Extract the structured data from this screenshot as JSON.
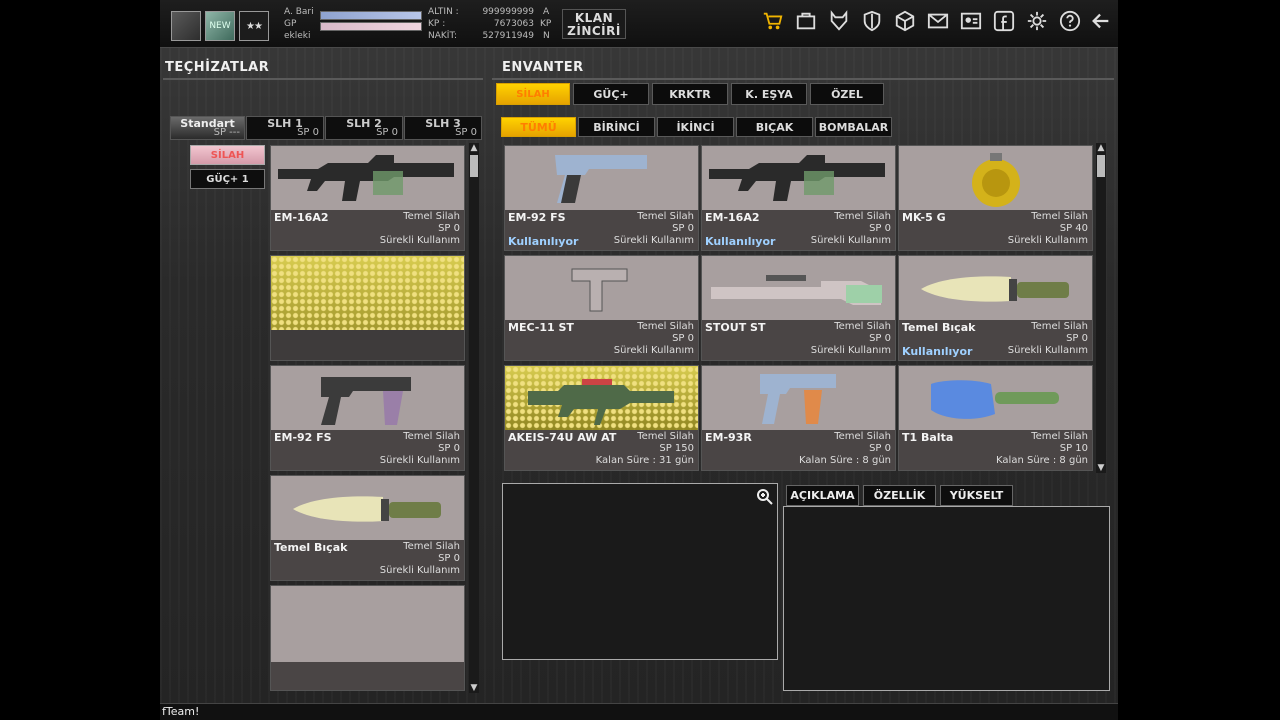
{
  "player": {
    "name": "A. Bari",
    "clan": "ekleki",
    "gp_label": "GP",
    "rank_badge": "★★",
    "rank_icon_text": "NEW"
  },
  "currency": {
    "altin_label": "ALTIN :",
    "altin_value": "999999999",
    "altin_unit": "A",
    "kp_label": "KP :",
    "kp_value": "7673063",
    "kp_unit": "KP",
    "nakit_label": "NAKİT:",
    "nakit_value": "527911949",
    "nakit_unit": "N"
  },
  "klan_button": {
    "line1": "KLAN",
    "line2": "ZİNCİRİ"
  },
  "toolbar_icons": [
    "cart-icon",
    "bag-icon",
    "wolf-icon",
    "shield-icon",
    "box-icon",
    "mail-icon",
    "profile-card-icon",
    "facebook-icon",
    "gear-icon",
    "help-icon",
    "back-arrow-icon"
  ],
  "left": {
    "title": "TEÇHİZATLAR",
    "slots": [
      {
        "label": "Standart",
        "sp": "SP ---"
      },
      {
        "label": "SLH 1",
        "sp": "SP 0"
      },
      {
        "label": "SLH 2",
        "sp": "SP 0"
      },
      {
        "label": "SLH 3",
        "sp": "SP 0"
      }
    ],
    "side_buttons": [
      "SİLAH",
      "GÜÇ+ 1"
    ],
    "cards": [
      {
        "name": "EM-16A2",
        "type": "Temel Silah",
        "sp": "SP 0",
        "dur": "Sürekli Kullanım",
        "art": "rifle"
      },
      {
        "name": "",
        "type": "",
        "sp": "",
        "dur": "",
        "art": "hex"
      },
      {
        "name": "EM-92 FS",
        "type": "Temel Silah",
        "sp": "SP 0",
        "dur": "Sürekli Kullanım",
        "art": "pistol"
      },
      {
        "name": "Temel Bıçak",
        "type": "Temel Silah",
        "sp": "SP 0",
        "dur": "Sürekli Kullanım",
        "art": "knife"
      },
      {
        "name": "",
        "type": "",
        "sp": "",
        "dur": "",
        "art": "empty"
      }
    ]
  },
  "right": {
    "title": "ENVANTER",
    "main_tabs": [
      "SİLAH",
      "GÜÇ+",
      "KRKTR",
      "K. EŞYA",
      "ÖZEL"
    ],
    "sub_tabs": [
      "TÜMÜ",
      "BİRİNCİ",
      "İKİNCİ",
      "BIÇAK",
      "BOMBALAR"
    ],
    "items": [
      {
        "name": "EM-92 FS",
        "type": "Temel Silah",
        "sp": "SP 0",
        "dur": "Sürekli Kullanım",
        "used": "Kullanılıyor",
        "art": "pistol"
      },
      {
        "name": "EM-16A2",
        "type": "Temel Silah",
        "sp": "SP 0",
        "dur": "Sürekli Kullanım",
        "used": "Kullanılıyor",
        "art": "rifle"
      },
      {
        "name": "MK-5 G",
        "type": "Temel Silah",
        "sp": "SP 40",
        "dur": "Sürekli Kullanım",
        "used": "",
        "art": "grenade"
      },
      {
        "name": "MEC-11 ST",
        "type": "Temel Silah",
        "sp": "SP 0",
        "dur": "Sürekli Kullanım",
        "used": "",
        "art": "smg"
      },
      {
        "name": "STOUT ST",
        "type": "Temel Silah",
        "sp": "SP 0",
        "dur": "Sürekli Kullanım",
        "used": "",
        "art": "sniper"
      },
      {
        "name": "Temel Bıçak",
        "type": "Temel Silah",
        "sp": "SP 0",
        "dur": "Sürekli Kullanım",
        "used": "Kullanılıyor",
        "art": "knife"
      },
      {
        "name": "AKEIS-74U AW AT",
        "type": "Temel Silah",
        "sp": "SP 150",
        "dur": "Kalan Süre : 31 gün",
        "used": "",
        "art": "ak"
      },
      {
        "name": "EM-93R",
        "type": "Temel Silah",
        "sp": "SP 0",
        "dur": "Kalan Süre : 8 gün",
        "used": "",
        "art": "pistol2"
      },
      {
        "name": "T1 Balta",
        "type": "Temel Silah",
        "sp": "SP 10",
        "dur": "Kalan Süre : 8 gün",
        "used": "",
        "art": "axe"
      }
    ],
    "desc_tabs": [
      "AÇIKLAMA",
      "ÖZELLİK",
      "YÜKSELT"
    ]
  },
  "status": {
    "text": "fTeam!"
  }
}
